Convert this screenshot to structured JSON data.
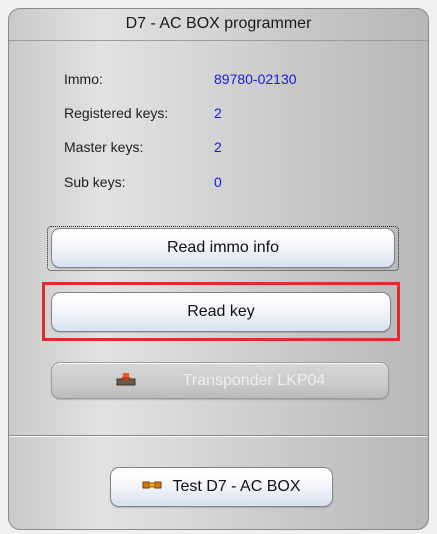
{
  "panel": {
    "title": "D7 - AC BOX programmer"
  },
  "info": {
    "immo_label": "Immo:",
    "immo_value": "89780-02130",
    "registered_keys_label": "Registered keys:",
    "registered_keys_value": "2",
    "master_keys_label": "Master keys:",
    "master_keys_value": "2",
    "sub_keys_label": "Sub keys:",
    "sub_keys_value": "0"
  },
  "buttons": {
    "read_immo_info": "Read immo info",
    "read_key": "Read key",
    "transponder": "Transponder LKP04",
    "test_box": "Test D7 - AC BOX"
  },
  "icons": {
    "transponder_icon": "download-chip-icon",
    "test_icon": "connector-icon"
  },
  "colors": {
    "value_text": "#1a1ad8",
    "highlight_border": "#e32b2b"
  }
}
